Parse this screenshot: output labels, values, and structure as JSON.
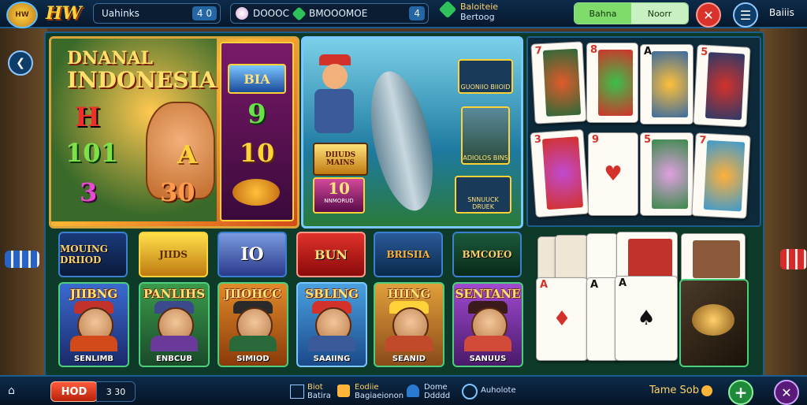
{
  "top": {
    "logo_badge": "HW",
    "logo_text": "HW",
    "pill1_label": "Uahinks",
    "pill1_value": "4 0",
    "pill2_label": "DOOOC",
    "pill3_label": "BMOOOMOE",
    "pill3_value": "4",
    "promo_line1": "Baloiteie",
    "promo_line2": "Bertoog",
    "login": "Bahna",
    "register": "Noorr",
    "menu_label": "Baiiis"
  },
  "panels": {
    "main_title_1": "DNANAL",
    "main_title_2": "INDONESIA",
    "main_n1": "H",
    "main_n2": "101",
    "main_n3": "3",
    "main_n4": "A",
    "main_n5": "30",
    "side_badge": "BIA",
    "side_n1": "9",
    "side_n2": "10",
    "fish_badge1": "DIIUDS MAINS",
    "fish_badge2": "10",
    "fish_badge2_sub": "NNMORUD",
    "fish_side1": "GUONIIO BIIOID",
    "fish_side2": "ADIOLOS BINS",
    "fish_side3": "SNNUUCK DRUEK"
  },
  "tiles": [
    "MOUING DRIIOD",
    "JIIDS",
    "IO",
    "BUN",
    "BRISIIA",
    "BMCOEO"
  ],
  "characters": [
    {
      "title": "JIIBNG",
      "sub": "SENLIMB"
    },
    {
      "title": "PANLIHS",
      "sub": "ENBCUB"
    },
    {
      "title": "JIIOHCC",
      "sub": "SIMIOD"
    },
    {
      "title": "SBLING",
      "sub": "SAAIING"
    },
    {
      "title": "HIING",
      "sub": "SEANID"
    },
    {
      "title": "SENTANE",
      "sub": "SANUUS"
    }
  ],
  "cards_top": [
    "7",
    "8",
    "A",
    "5",
    "3",
    "9",
    "5",
    "7"
  ],
  "cards_bottom": [
    "A",
    "A",
    "A"
  ],
  "bottom": {
    "hold_label": "HOD",
    "hold_value": "3 30",
    "nav1_title": "Biot",
    "nav1_sub": "Batira",
    "nav2_title": "Eodiie",
    "nav2_sub": "Bagiaeionon",
    "nav3_title": "Dome",
    "nav3_sub": "Ddddd",
    "nav4_title": "Auholote",
    "tame_label": "Tame Sob"
  }
}
